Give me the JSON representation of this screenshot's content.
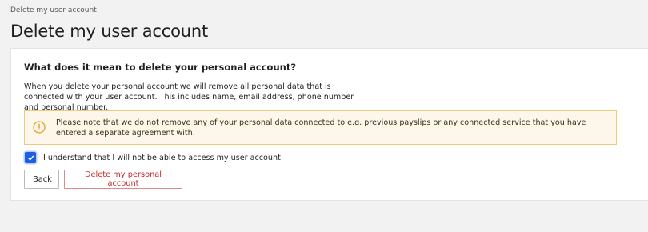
{
  "breadcrumb": {
    "current": "Delete my user account"
  },
  "page": {
    "title": "Delete my user account"
  },
  "card": {
    "heading": "What does it mean to delete your personal account?",
    "description": "When you delete your personal account we will remove all personal data that is connected with your user account. This includes name, email address, phone number and personal number.",
    "alert": {
      "icon": "warning-circle-icon",
      "text": "Please note that we do not remove any of your personal data connected to e.g. previous payslips or any connected service that you have entered a separate agreement with."
    },
    "confirm": {
      "checked": true,
      "label": "I understand that I will not be able to access my user account"
    },
    "buttons": {
      "back": "Back",
      "delete": "Delete my personal account"
    }
  },
  "colors": {
    "accent": "#1c5fe0",
    "danger": "#c92b2b",
    "warning_border": "#f2c879",
    "warning_bg": "#fdf6ea"
  }
}
